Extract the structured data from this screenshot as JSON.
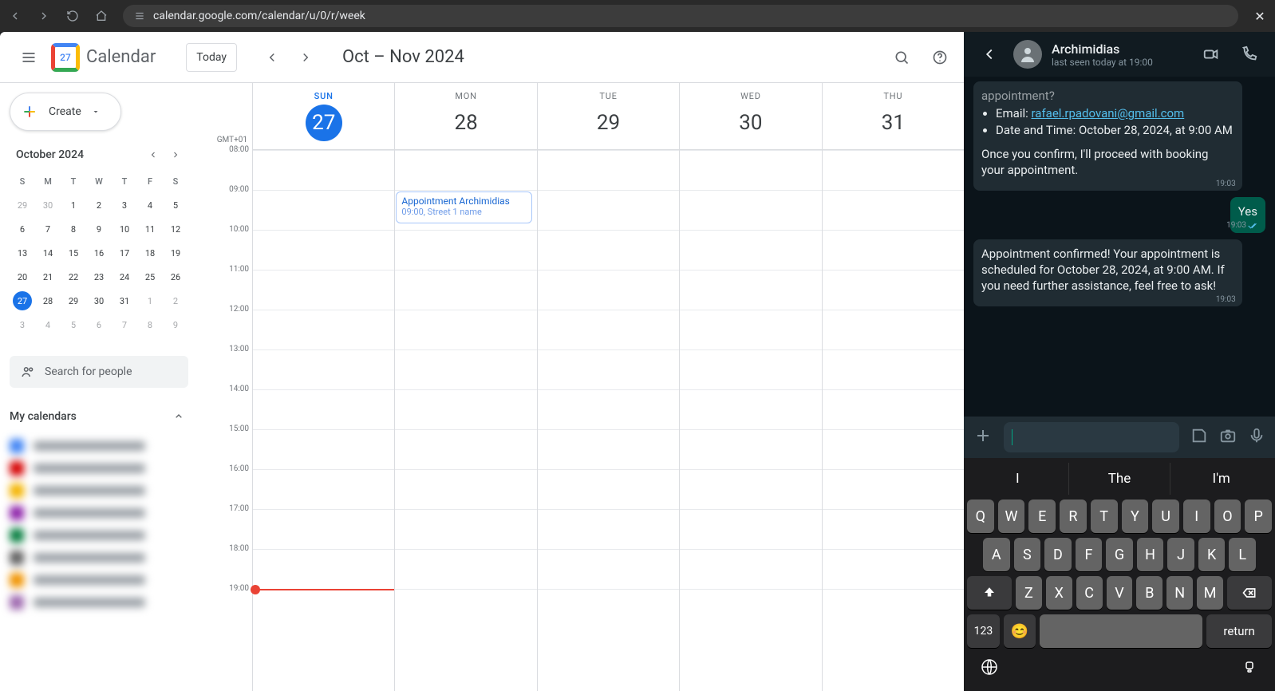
{
  "browser": {
    "url": "calendar.google.com/calendar/u/0/r/week"
  },
  "calendar": {
    "app_name": "Calendar",
    "logo_day": "27",
    "today_label": "Today",
    "date_range": "Oct – Nov 2024",
    "create_label": "Create",
    "timezone": "GMT+01",
    "mini_title": "October 2024",
    "mini_dow": [
      "S",
      "M",
      "T",
      "W",
      "T",
      "F",
      "S"
    ],
    "mini_weeks": [
      [
        {
          "n": "29",
          "m": true
        },
        {
          "n": "30",
          "m": true
        },
        {
          "n": "1"
        },
        {
          "n": "2"
        },
        {
          "n": "3"
        },
        {
          "n": "4"
        },
        {
          "n": "5"
        }
      ],
      [
        {
          "n": "6"
        },
        {
          "n": "7"
        },
        {
          "n": "8"
        },
        {
          "n": "9"
        },
        {
          "n": "10"
        },
        {
          "n": "11"
        },
        {
          "n": "12"
        }
      ],
      [
        {
          "n": "13"
        },
        {
          "n": "14"
        },
        {
          "n": "15"
        },
        {
          "n": "16"
        },
        {
          "n": "17"
        },
        {
          "n": "18"
        },
        {
          "n": "19"
        }
      ],
      [
        {
          "n": "20"
        },
        {
          "n": "21"
        },
        {
          "n": "22"
        },
        {
          "n": "23"
        },
        {
          "n": "24"
        },
        {
          "n": "25"
        },
        {
          "n": "26"
        }
      ],
      [
        {
          "n": "27",
          "today": true
        },
        {
          "n": "28"
        },
        {
          "n": "29"
        },
        {
          "n": "30"
        },
        {
          "n": "31"
        },
        {
          "n": "1",
          "m": true
        },
        {
          "n": "2",
          "m": true
        }
      ],
      [
        {
          "n": "3",
          "m": true
        },
        {
          "n": "4",
          "m": true
        },
        {
          "n": "5",
          "m": true
        },
        {
          "n": "6",
          "m": true
        },
        {
          "n": "7",
          "m": true
        },
        {
          "n": "8",
          "m": true
        },
        {
          "n": "9",
          "m": true
        }
      ]
    ],
    "search_people_placeholder": "Search for people",
    "my_calendars_label": "My calendars",
    "calendar_colors": [
      "#4285f4",
      "#d50000",
      "#f4b400",
      "#8e24aa"
    ],
    "days": [
      {
        "dow": "SUN",
        "num": "27",
        "today": true
      },
      {
        "dow": "MON",
        "num": "28"
      },
      {
        "dow": "TUE",
        "num": "29"
      },
      {
        "dow": "WED",
        "num": "30"
      },
      {
        "dow": "THU",
        "num": "31"
      }
    ],
    "hours": [
      "08:00",
      "09:00",
      "10:00",
      "11:00",
      "12:00",
      "13:00",
      "14:00",
      "15:00",
      "16:00",
      "17:00",
      "18:00",
      "19:00"
    ],
    "event": {
      "title": "Appointment Archimidias",
      "subtitle": "09:00, Street 1 name"
    },
    "now_hour_label": "19:00"
  },
  "chat": {
    "contact_name": "Archimidias",
    "status": "last seen today at 19:00",
    "messages": [
      {
        "type": "in",
        "partial_top": "appointment?",
        "list": [
          {
            "label": "Email:",
            "link": "rafael.rpadovani@gmail.com"
          },
          {
            "label": "Date and Time: October 28, 2024, at 9:00 AM"
          }
        ],
        "tail": "Once you confirm, I'll proceed with booking your appointment.",
        "time": "19:03"
      },
      {
        "type": "out",
        "text": "Yes",
        "time": "19:03",
        "read": true
      },
      {
        "type": "in",
        "text": "Appointment confirmed! Your appointment is scheduled for October 28, 2024, at 9:00 AM. If you need further assistance, feel free to ask!",
        "time": "19:03"
      }
    ],
    "suggestions": [
      "I",
      "The",
      "I'm"
    ],
    "keys_r1": [
      "Q",
      "W",
      "E",
      "R",
      "T",
      "Y",
      "U",
      "I",
      "O",
      "P"
    ],
    "keys_r2": [
      "A",
      "S",
      "D",
      "F",
      "G",
      "H",
      "J",
      "K",
      "L"
    ],
    "keys_r3": [
      "Z",
      "X",
      "C",
      "V",
      "B",
      "N",
      "M"
    ],
    "key_123": "123",
    "key_return": "return"
  }
}
